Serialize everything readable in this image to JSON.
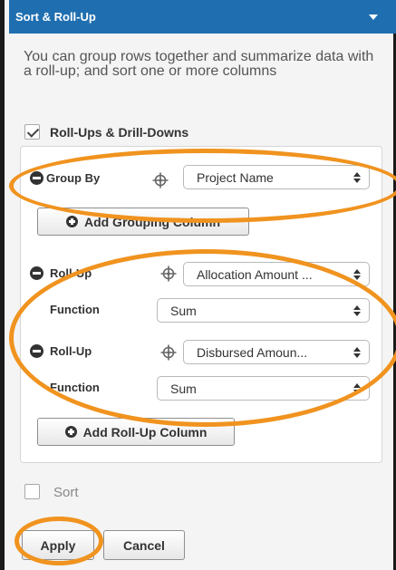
{
  "header": {
    "title": "Sort & Roll-Up"
  },
  "description": "You can group rows together and summarize data with a roll-up; and sort one or more columns",
  "rollups_checkbox": {
    "label": "Roll-Ups & Drill-Downs",
    "checked": true
  },
  "group_by": {
    "label": "Group By",
    "value": "Project Name"
  },
  "add_grouping_label": "Add Grouping Column",
  "rollups": [
    {
      "label": "Roll-Up",
      "column": "Allocation Amount ...",
      "function_label": "Function",
      "function": "Sum"
    },
    {
      "label": "Roll-Up",
      "column": "Disbursed Amoun...",
      "function_label": "Function",
      "function": "Sum"
    }
  ],
  "add_rollup_label": "Add Roll-Up Column",
  "sort_checkbox": {
    "label": "Sort",
    "checked": false
  },
  "actions": {
    "apply": "Apply",
    "cancel": "Cancel"
  },
  "colors": {
    "header": "#1f6fb0",
    "highlight": "#f0931f"
  }
}
